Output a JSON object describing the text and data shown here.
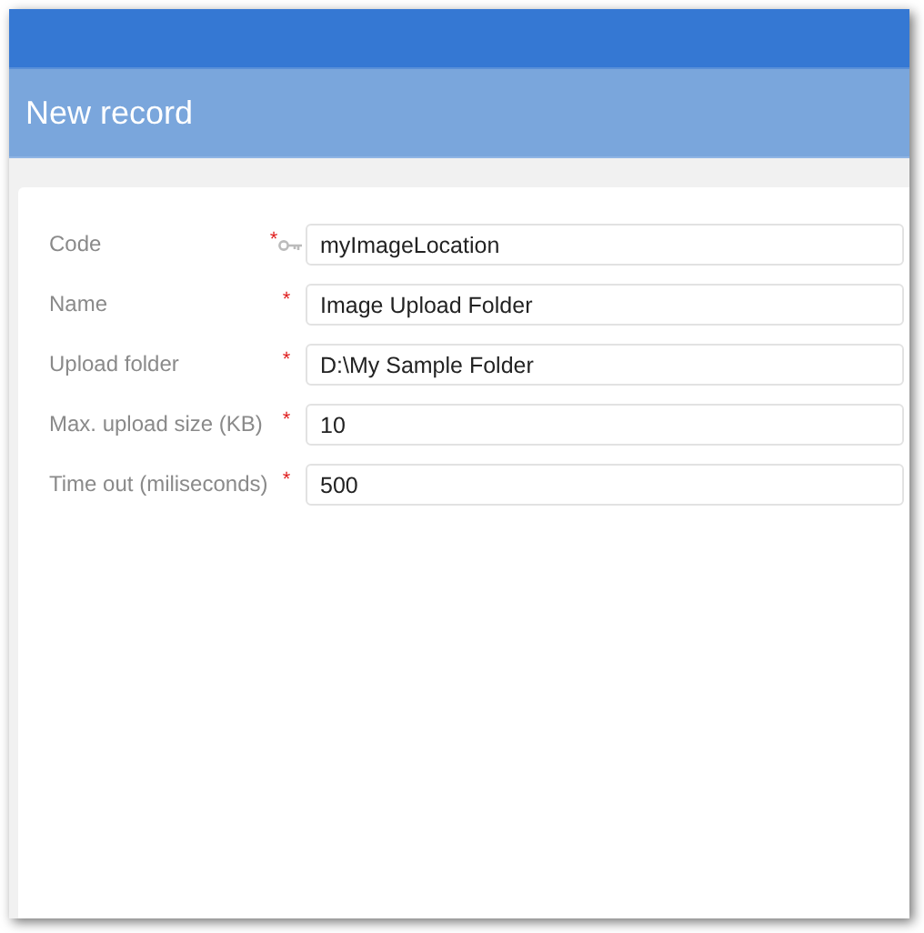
{
  "window": {
    "title": "New record"
  },
  "fields": [
    {
      "label": "Code",
      "mark": "*",
      "key": true,
      "value": "myImageLocation"
    },
    {
      "label": "Name",
      "mark": "*",
      "key": false,
      "value": "Image Upload Folder"
    },
    {
      "label": "Upload folder",
      "mark": "*",
      "key": false,
      "value": "D:\\My Sample Folder"
    },
    {
      "label": "Max. upload size (KB)",
      "mark": "*",
      "key": false,
      "value": "10"
    },
    {
      "label": "Time out (miliseconds)",
      "mark": "*",
      "key": false,
      "value": "500"
    }
  ]
}
